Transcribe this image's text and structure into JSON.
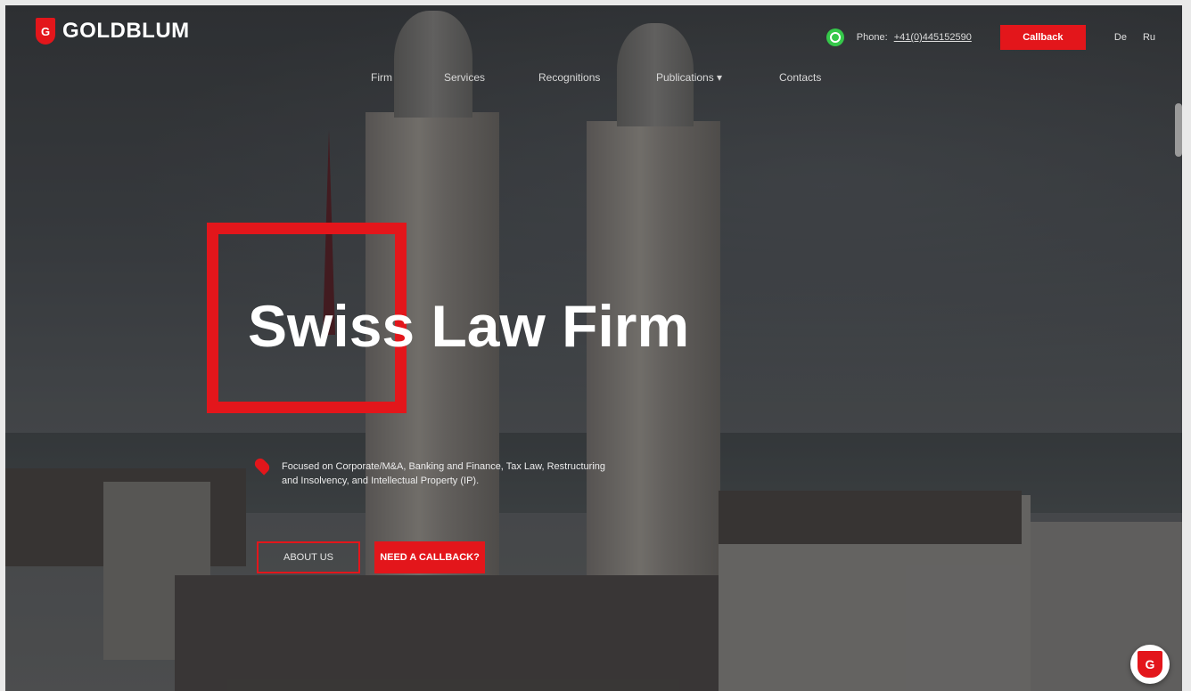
{
  "brand": {
    "name": "GOLDBLUM",
    "mark_glyph": "G"
  },
  "header": {
    "phone_label": "Phone:",
    "phone_number": "+41(0)445152590",
    "callback_label": "Callback",
    "languages": [
      "De",
      "Ru"
    ]
  },
  "nav": {
    "items": [
      {
        "label": "Firm"
      },
      {
        "label": "Services"
      },
      {
        "label": "Recognitions"
      },
      {
        "label": "Publications ▾"
      },
      {
        "label": "Contacts"
      }
    ]
  },
  "hero": {
    "title": "Swiss Law Firm",
    "focus_text": "Focused on Corporate/M&A, Banking and Finance, Tax Law, Restructuring and Insolvency, and Intellectual Property (IP).",
    "about_label": "ABOUT US",
    "callback_label": "NEED A CALLBACK?"
  },
  "colors": {
    "accent": "#e3161b",
    "whatsapp": "#35c84a"
  },
  "icons": {
    "whatsapp": "whatsapp-icon",
    "pin": "map-pin-icon",
    "floating": "goldblum-badge-icon"
  }
}
